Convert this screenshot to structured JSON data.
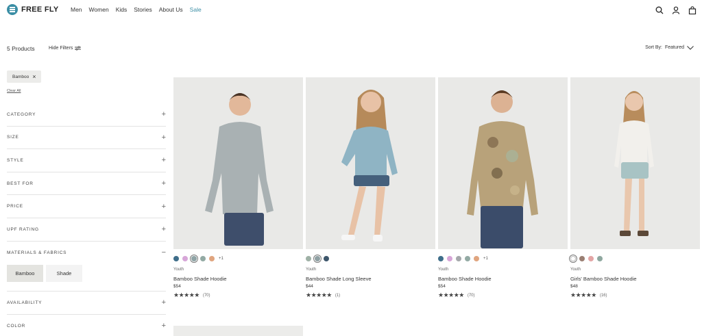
{
  "brand": {
    "name": "FREE FLY",
    "logo_icon": "freefly-logo-icon"
  },
  "nav": [
    "Men",
    "Women",
    "Kids",
    "Stories",
    "About Us",
    "Sale"
  ],
  "header_icons": [
    "search-icon",
    "account-icon",
    "cart-icon"
  ],
  "toolbar": {
    "product_count": "5 Products",
    "hide_filters": "Hide Filters",
    "sort_label": "Sort By:",
    "sort_value": "Featured"
  },
  "active_filter": {
    "label": "Bamboo",
    "clear_all": "Clear All"
  },
  "filters": [
    {
      "label": "CATEGORY",
      "toggle": "+"
    },
    {
      "label": "SIZE",
      "toggle": "+"
    },
    {
      "label": "STYLE",
      "toggle": "+"
    },
    {
      "label": "BEST FOR",
      "toggle": "+"
    },
    {
      "label": "PRICE",
      "toggle": "+"
    },
    {
      "label": "UPF RATING",
      "toggle": "+"
    },
    {
      "label": "MATERIALS & FABRICS",
      "toggle": "−"
    },
    {
      "label": "AVAILABILITY",
      "toggle": "+"
    },
    {
      "label": "COLOR",
      "toggle": "+"
    }
  ],
  "material_options": [
    "Bamboo",
    "Shade"
  ],
  "products": [
    {
      "category": "Youth",
      "name": "Bamboo Shade Hoodie",
      "price": "$54",
      "stars": "★★★★★",
      "reviews": "(70)",
      "more_colors": "+1",
      "swatches": [
        "#3f6e8a",
        "#d7a6d8",
        "#8fa4a6",
        "#93aaa4",
        "#e0a57f"
      ],
      "shirt_color": "#a9b1b3",
      "shorts_color": "#3e4e6b"
    },
    {
      "category": "Youth",
      "name": "Bamboo Shade Long Sleeve",
      "price": "$44",
      "stars": "★★★★★",
      "reviews": "(1)",
      "more_colors": "",
      "swatches": [
        "#9fb1a6",
        "#8fa0a3",
        "#3d566b"
      ],
      "shirt_color": "#8fb4c4",
      "shorts_color": "#45607c"
    },
    {
      "category": "Youth",
      "name": "Bamboo Shade Hoodie",
      "price": "$54",
      "stars": "★★★★★",
      "reviews": "(70)",
      "more_colors": "+1",
      "swatches": [
        "#3f6e8a",
        "#d7a6d8",
        "#a5a8ab",
        "#93aaa4",
        "#e0a57f"
      ],
      "shirt_color": "#b8a27a",
      "shorts_color": "#3b4c6a"
    },
    {
      "category": "Youth",
      "name": "Girls' Bamboo Shade Hoodie",
      "price": "$48",
      "stars": "★★★★★",
      "reviews": "(16)",
      "more_colors": "",
      "swatches": [
        "#ffffff",
        "#9a7f73",
        "#e3a5a5",
        "#8fa8a0"
      ],
      "shirt_color": "#f2f0ec",
      "shorts_color": "#a8c3c4"
    }
  ]
}
